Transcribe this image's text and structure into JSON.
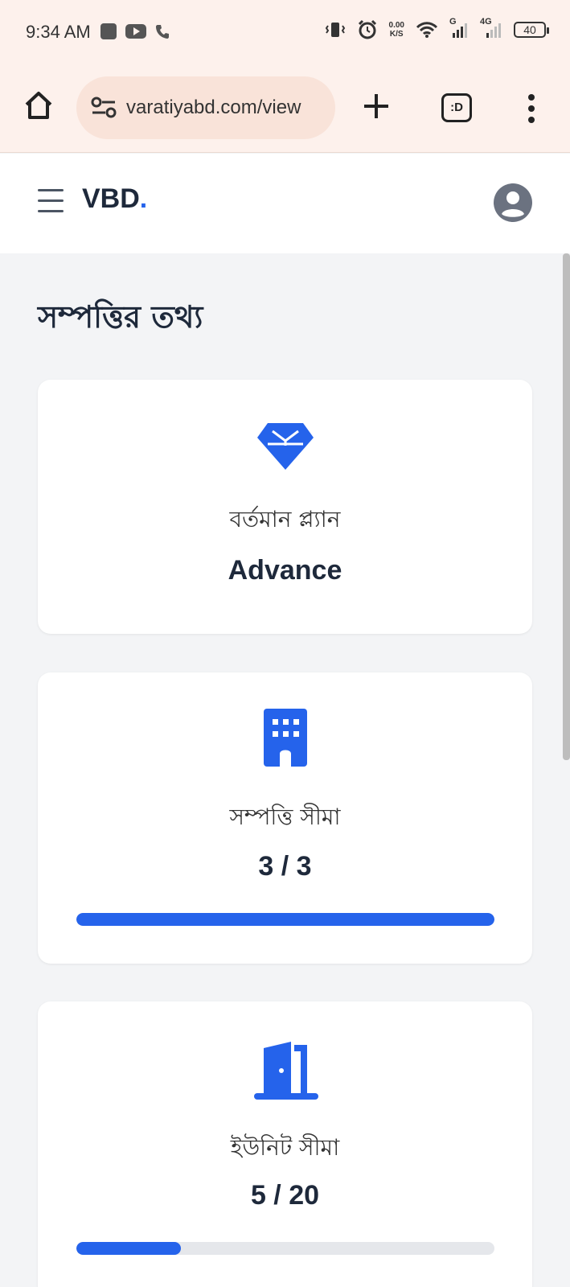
{
  "status_bar": {
    "time": "9:34 AM",
    "net_speed_value": "0.00",
    "net_speed_unit": "K/S",
    "signal1_label": "G",
    "signal2_label": "4G",
    "battery": "40"
  },
  "browser": {
    "url": "varatiyabd.com/view",
    "tabs_label": ":D"
  },
  "header": {
    "logo": "VBD",
    "logo_dot": "."
  },
  "page": {
    "title": "সম্পত্তির তথ্য"
  },
  "cards": [
    {
      "label": "বর্তমান প্ল্যান",
      "value": "Advance",
      "icon": "diamond-icon"
    },
    {
      "label": "সম্পত্তি সীমা",
      "value": "3 / 3",
      "icon": "building-icon",
      "progress": 1.0
    },
    {
      "label": "ইউনিট সীমা",
      "value": "5 / 20",
      "icon": "door-open-icon",
      "progress": 0.25
    }
  ],
  "colors": {
    "accent": "#2563eb",
    "status_bg": "#fdf1ec",
    "page_bg": "#f3f4f6"
  }
}
